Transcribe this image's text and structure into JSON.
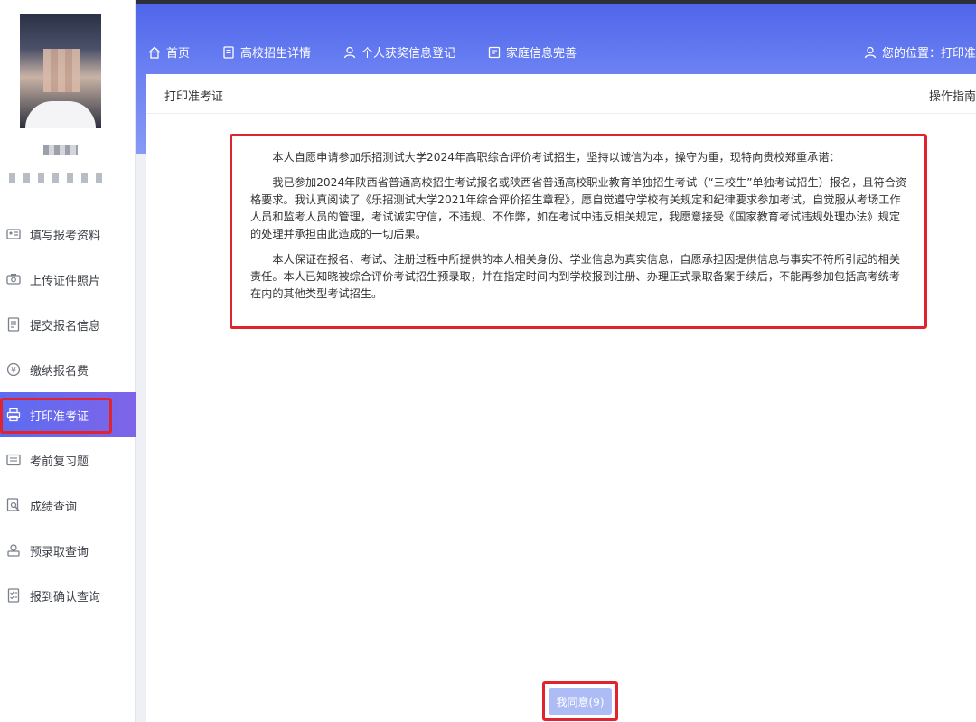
{
  "sidebar": {
    "items": [
      {
        "label": "填写报考资料",
        "icon": "id-card-icon"
      },
      {
        "label": "上传证件照片",
        "icon": "camera-icon"
      },
      {
        "label": "提交报名信息",
        "icon": "document-icon"
      },
      {
        "label": "缴纳报名费",
        "icon": "yen-icon"
      },
      {
        "label": "打印准考证",
        "icon": "printer-icon",
        "active": true
      },
      {
        "label": "考前复习题",
        "icon": "list-icon"
      },
      {
        "label": "成绩查询",
        "icon": "search-doc-icon"
      },
      {
        "label": "预录取查询",
        "icon": "badge-icon"
      },
      {
        "label": "报到确认查询",
        "icon": "checklist-icon"
      }
    ]
  },
  "topnav": {
    "items": [
      {
        "label": "首页",
        "icon": "home-icon"
      },
      {
        "label": "高校招生详情",
        "icon": "book-icon"
      },
      {
        "label": "个人获奖信息登记",
        "icon": "user-icon"
      },
      {
        "label": "家庭信息完善",
        "icon": "form-icon"
      }
    ],
    "location_label": "您的位置：打印准"
  },
  "card": {
    "title": "打印准考证",
    "guide": "操作指南"
  },
  "pledge": {
    "paragraphs": [
      "本人自愿申请参加乐招测试大学2024年高职综合评价考试招生，坚持以诚信为本，操守为重，现特向贵校郑重承诺：",
      "我已参加2024年陕西省普通高校招生考试报名或陕西省普通高校职业教育单独招生考试（“三校生”单独考试招生）报名，且符合资格要求。我认真阅读了《乐招测试大学2021年综合评价招生章程》，愿自觉遵守学校有关规定和纪律要求参加考试，自觉服从考场工作人员和监考人员的管理，考试诚实守信，不违规、不作弊，如在考试中违反相关规定，我愿意接受《国家教育考试违规处理办法》规定的处理并承担由此造成的一切后果。",
      "本人保证在报名、考试、注册过程中所提供的本人相关身份、学业信息为真实信息，自愿承担因提供信息与事实不符所引起的相关责任。本人已知晓被综合评价考试招生预录取，并在指定时间内到学校报到注册、办理正式录取备案手续后，不能再参加包括高考统考在内的其他类型考试招生。"
    ]
  },
  "agree_button": {
    "label": "我同意(9)"
  },
  "colors": {
    "accent": "#5b6cf2",
    "highlight": "#e0242d",
    "button_disabled": "#aebcf6"
  }
}
